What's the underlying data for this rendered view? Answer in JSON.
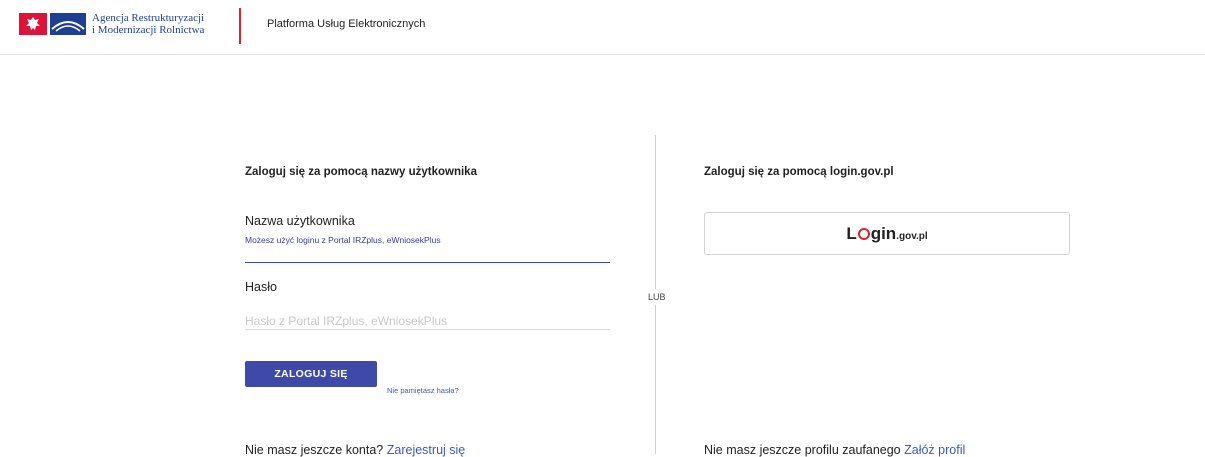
{
  "header": {
    "agency_line1": "Agencja Restrukturyzacji",
    "agency_line2": "i Modernizacji Rolnictwa",
    "platform_title": "Platforma Usług Elektronicznych"
  },
  "login_form": {
    "title": "Zaloguj się za pomocą nazwy użytkownika",
    "username_label": "Nazwa użytkownika",
    "username_hint": "Możesz użyć loginu z Portal IRZplus, eWniosekPlus",
    "username_value": "",
    "password_label": "Hasło",
    "password_placeholder": "Hasło z Portal IRZplus, eWniosekPlus",
    "login_button": "ZALOGUJ SIĘ",
    "forgot_password": "Nie pamiętasz hasła?",
    "no_account_text": "Nie masz jeszcze konta?",
    "register_link": "Zarejestruj się"
  },
  "separator": {
    "label": "LUB"
  },
  "login_gov": {
    "title": "Zaloguj się za pomocą login.gov.pl",
    "logo_L": "L",
    "logo_gin": "gin",
    "logo_domain": ".gov.pl",
    "no_profile_text": "Nie masz jeszcze profilu zaufanego",
    "create_profile_link": "Załóż profil"
  },
  "colors": {
    "primary": "#3f4aa8",
    "link": "#3a5bbf",
    "header_red": "#d9262b",
    "emblem_red": "#dc143c",
    "agency_blue": "#1f3f93"
  }
}
